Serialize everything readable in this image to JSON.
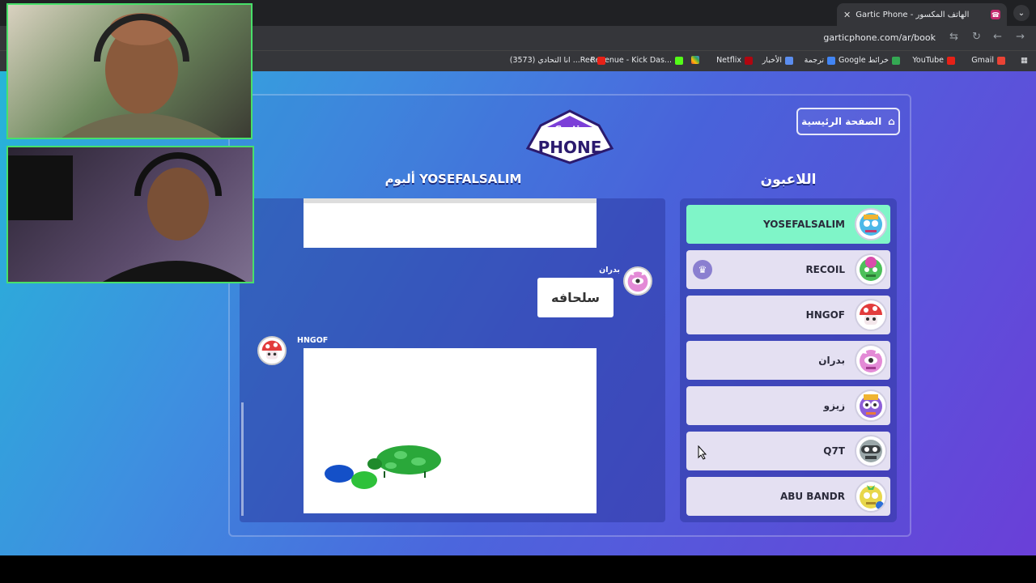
{
  "browser": {
    "tab_title": "Gartic Phone - الهاتف المكسور",
    "tab_favicon": "☎",
    "url": "garticphone.com/ar/book",
    "new_tab": "+",
    "menu": "⌄",
    "bookmarks": [
      "Gmail",
      "YouTube",
      "Google خرائط",
      "ترجمة",
      "الأخبار",
      "Netflix",
      "Revenue - Kick Das...",
      "(3573) انا التحادي ...Rec"
    ]
  },
  "game": {
    "home_button": "الصفحة الرئيسية",
    "logo_top": "Gartic",
    "logo_main": "PHONE",
    "players_title": "اللاعبون",
    "album_title": "ألبوم YOSEFALSALIM",
    "players": [
      {
        "name": "YOSEFALSALIM",
        "active": true,
        "color": "#4cb8e8"
      },
      {
        "name": "RECOIL",
        "crown": true,
        "color": "#4cc05a"
      },
      {
        "name": "HNGOF",
        "color": "#e23c3c"
      },
      {
        "name": "بدران",
        "color": "#e38ad6"
      },
      {
        "name": "زيزو",
        "color": "#8e5fd8"
      },
      {
        "name": "Q7T",
        "color": "#9aa7a9"
      },
      {
        "name": "ABU BANDR",
        "color": "#e8d74b"
      }
    ],
    "album": {
      "msg1_sender": "بدران",
      "msg1_text": "سلحافه",
      "msg2_sender": "HNGOF"
    }
  }
}
